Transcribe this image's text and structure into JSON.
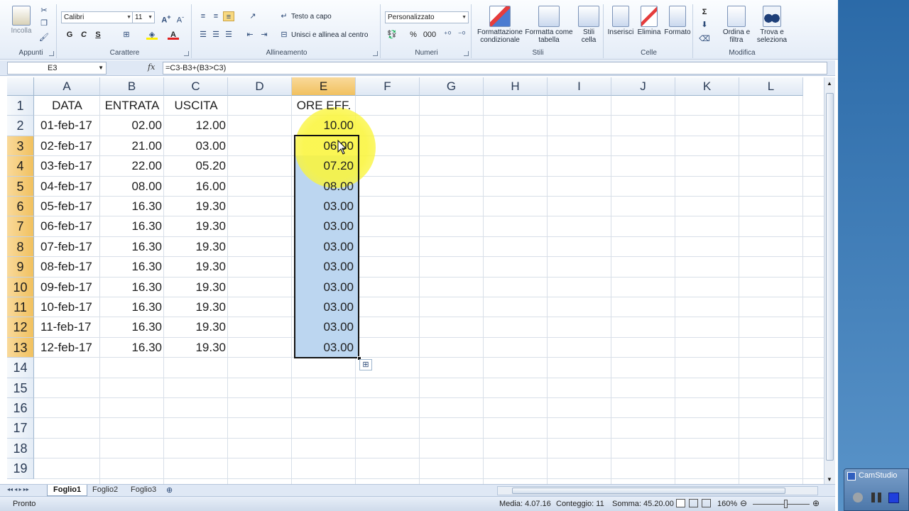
{
  "ribbon": {
    "clipboard": {
      "label": "Appunti",
      "paste": "Incolla"
    },
    "font": {
      "label": "Carattere",
      "name": "Calibri",
      "size": "11",
      "bold": "G",
      "italic": "C",
      "underline": "S"
    },
    "alignment": {
      "label": "Allineamento",
      "wrap": "Testo a capo",
      "merge": "Unisci e allinea al centro"
    },
    "number": {
      "label": "Numeri",
      "format": "Personalizzato",
      "percent": "%",
      "thousands": "000"
    },
    "styles": {
      "label": "Stili",
      "conditional": "Formattazione condizionale",
      "table": "Formatta come tabella",
      "cell": "Stili cella"
    },
    "cells": {
      "label": "Celle",
      "insert": "Inserisci",
      "delete": "Elimina",
      "format": "Formato"
    },
    "editing": {
      "label": "Modifica",
      "sum": "Σ",
      "sort": "Ordina e filtra",
      "find": "Trova e seleziona"
    }
  },
  "formula_bar": {
    "name_box": "E3",
    "fx": "fx",
    "formula": "=C3-B3+(B3>C3)"
  },
  "columns": [
    "A",
    "B",
    "C",
    "D",
    "E",
    "F",
    "G",
    "H",
    "I",
    "J",
    "K",
    "L"
  ],
  "rows": [
    "1",
    "2",
    "3",
    "4",
    "5",
    "6",
    "7",
    "8",
    "9",
    "10",
    "11",
    "12",
    "13",
    "14",
    "15",
    "16",
    "17",
    "18",
    "19"
  ],
  "headers": {
    "a": "DATA",
    "b": "ENTRATA",
    "c": "USCITA",
    "e": "ORE EFF."
  },
  "data_rows": [
    {
      "date": "01-feb-17",
      "in": "02.00",
      "out": "12.00",
      "hours": "10.00"
    },
    {
      "date": "02-feb-17",
      "in": "21.00",
      "out": "03.00",
      "hours": "06.00"
    },
    {
      "date": "03-feb-17",
      "in": "22.00",
      "out": "05.20",
      "hours": "07.20"
    },
    {
      "date": "04-feb-17",
      "in": "08.00",
      "out": "16.00",
      "hours": "08.00"
    },
    {
      "date": "05-feb-17",
      "in": "16.30",
      "out": "19.30",
      "hours": "03.00"
    },
    {
      "date": "06-feb-17",
      "in": "16.30",
      "out": "19.30",
      "hours": "03.00"
    },
    {
      "date": "07-feb-17",
      "in": "16.30",
      "out": "19.30",
      "hours": "03.00"
    },
    {
      "date": "08-feb-17",
      "in": "16.30",
      "out": "19.30",
      "hours": "03.00"
    },
    {
      "date": "09-feb-17",
      "in": "16.30",
      "out": "19.30",
      "hours": "03.00"
    },
    {
      "date": "10-feb-17",
      "in": "16.30",
      "out": "19.30",
      "hours": "03.00"
    },
    {
      "date": "11-feb-17",
      "in": "16.30",
      "out": "19.30",
      "hours": "03.00"
    },
    {
      "date": "12-feb-17",
      "in": "16.30",
      "out": "19.30",
      "hours": "03.00"
    }
  ],
  "sheets": [
    "Foglio1",
    "Foglio2",
    "Foglio3"
  ],
  "status": {
    "ready": "Pronto",
    "average": "Media: 4.07.16",
    "count": "Conteggio: 11",
    "sum": "Somma: 45.20.00",
    "zoom": "160%"
  },
  "camstudio": {
    "title": "CamStudio"
  },
  "colors": {
    "selection": "#bcd6f0",
    "header_selected": "#f1c15f",
    "highlight": "#faf53c"
  }
}
